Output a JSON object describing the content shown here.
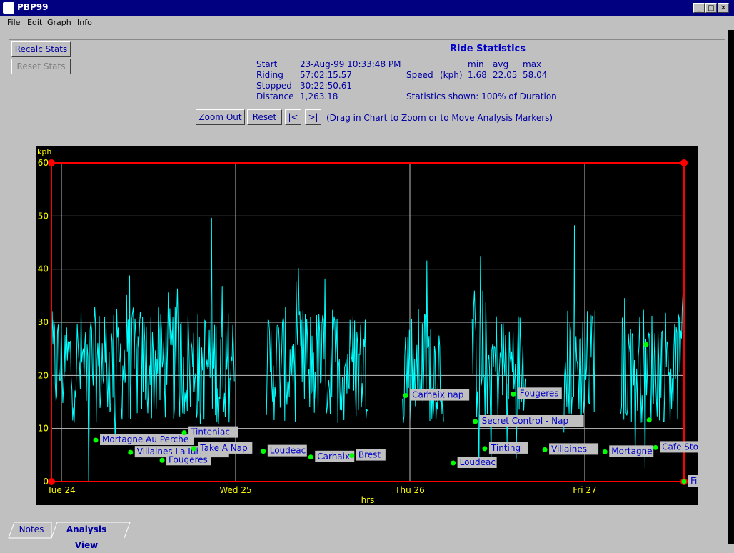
{
  "window": {
    "title": "PBP99"
  },
  "menu": [
    "File",
    "Edit",
    "Graph",
    "Info"
  ],
  "buttons": {
    "recalc": "Recalc Stats",
    "reset_stats": "Reset Stats",
    "zoom_out": "Zoom Out",
    "reset": "Reset",
    "first": "|<",
    "last": ">|"
  },
  "hint": "(Drag in Chart to Zoom or to Move Analysis Markers)",
  "stats": {
    "title": "Ride Statistics",
    "start_label": "Start",
    "start": "23-Aug-99 10:33:48 PM",
    "riding_label": "Riding",
    "riding": "57:02:15.57",
    "stopped_label": "Stopped",
    "stopped": "30:22:50.61",
    "distance_label": "Distance",
    "distance": "1,263.18",
    "col_min": "min",
    "col_avg": "avg",
    "col_max": "max",
    "speed_label": "Speed",
    "speed_unit": "(kph)",
    "speed_min": "1.68",
    "speed_avg": "22.05",
    "speed_max": "58.04",
    "shown": "Statistics shown: 100% of Duration"
  },
  "tabs": [
    "Notes",
    "Analysis View"
  ],
  "colors": {
    "trace": "#00ffff",
    "frame": "#ff0000",
    "marker": "#00ff00",
    "label_bg": "#c0c0c0",
    "label_fg": "#0000c8",
    "axis_text": "#ffff00",
    "grid": "#c0c0c0"
  },
  "chart_data": {
    "type": "line",
    "ylabel": "kph",
    "xlabel": "hrs",
    "ylim": [
      0,
      60
    ],
    "yticks": [
      0,
      10,
      20,
      30,
      40,
      50,
      60
    ],
    "xticks": [
      "Tue 24",
      "Wed 25",
      "Thu 26",
      "Fri 27"
    ],
    "grid": true,
    "speed_summary": {
      "min": 1.68,
      "avg": 22.05,
      "max": 58.04
    },
    "markers": [
      {
        "label": "Mortagne Au Perche",
        "t": 0.07,
        "y": 7.8
      },
      {
        "label": "Villaines La Juhel",
        "t": 0.125,
        "y": 5.5
      },
      {
        "label": "Fougeres",
        "t": 0.175,
        "y": 4.0
      },
      {
        "label": "Tinteniac",
        "t": 0.21,
        "y": 9.2
      },
      {
        "label": "Take A Nap",
        "t": 0.225,
        "y": 6.2
      },
      {
        "label": "Loudeac",
        "t": 0.335,
        "y": 5.7
      },
      {
        "label": "Carhaix",
        "t": 0.41,
        "y": 4.6
      },
      {
        "label": "Brest",
        "t": 0.475,
        "y": 4.9
      },
      {
        "label": "Carhaix nap",
        "t": 0.56,
        "y": 16.2
      },
      {
        "label": "Loudeac",
        "t": 0.635,
        "y": 3.5
      },
      {
        "label": "Secret Control - Nap",
        "t": 0.67,
        "y": 11.3
      },
      {
        "label": "Tinting",
        "t": 0.685,
        "y": 6.2
      },
      {
        "label": "Fougeres",
        "t": 0.73,
        "y": 16.5
      },
      {
        "label": "Villaines",
        "t": 0.78,
        "y": 6.0
      },
      {
        "label": "Mortagne",
        "t": 0.875,
        "y": 5.6
      },
      {
        "label": "Cafe Stop",
        "t": 0.955,
        "y": 6.4
      },
      {
        "label": "",
        "t": 0.94,
        "y": 25.8
      },
      {
        "label": "",
        "t": 0.945,
        "y": 11.6
      },
      {
        "label": "Finish!",
        "t": 1.0,
        "y": 0
      }
    ]
  }
}
